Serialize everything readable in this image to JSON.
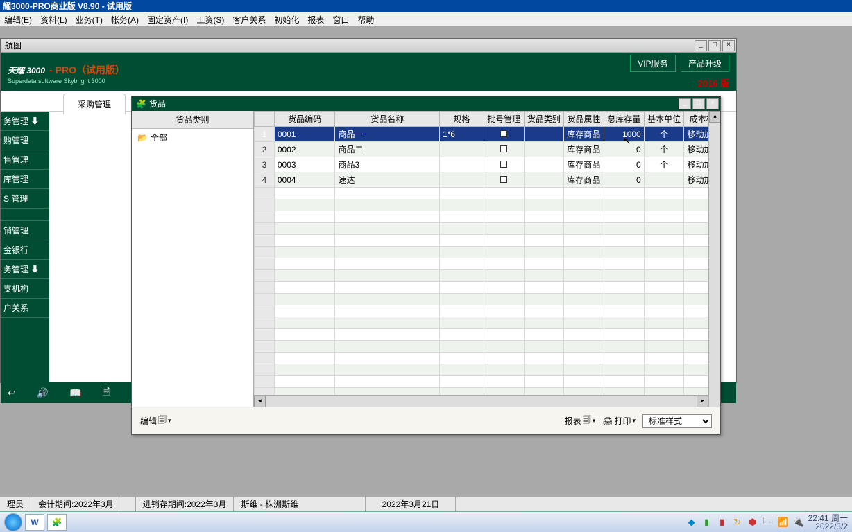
{
  "app": {
    "title": "耀3000-PRO商业版 V8.90 - 试用版"
  },
  "menu": [
    "编辑(E)",
    "资料(L)",
    "业务(T)",
    "帐务(A)",
    "固定资产(I)",
    "工资(S)",
    "客户关系",
    "初始化",
    "报表",
    "窗口",
    "帮助"
  ],
  "nav": {
    "title": "航图",
    "brand_title": "天耀 3000",
    "brand_pro": "- PRO（试用版）",
    "brand_sub": "Superdata software Skybright 3000",
    "vip_btn": "VIP服务",
    "upgrade_btn": "产品升级",
    "year": "2016 版",
    "tab_active": "采购管理",
    "sidebar": [
      "务管理 ⬇",
      "购管理",
      "售管理",
      "库管理",
      "S 管理",
      "",
      "销管理",
      "金银行",
      "务管理 ⬇",
      "支机构",
      "户关系"
    ]
  },
  "goods": {
    "title": "货品",
    "tree_header": "货品类别",
    "tree_root": "全部",
    "columns": [
      "",
      "货品编码",
      "货品名称",
      "规格",
      "批号管理",
      "货品类别",
      "货品属性",
      "总库存量",
      "基本单位",
      "成本栏"
    ],
    "rows": [
      {
        "n": "1",
        "code": "0001",
        "name": "商品一",
        "spec": "1*6",
        "batch": true,
        "cat": "",
        "attr": "库存商品",
        "stock": "1000",
        "unit": "个",
        "cost": "移动加"
      },
      {
        "n": "2",
        "code": "0002",
        "name": "商品二",
        "spec": "",
        "batch": false,
        "cat": "",
        "attr": "库存商品",
        "stock": "0",
        "unit": "个",
        "cost": "移动加"
      },
      {
        "n": "3",
        "code": "0003",
        "name": "商品3",
        "spec": "",
        "batch": false,
        "cat": "",
        "attr": "库存商品",
        "stock": "0",
        "unit": "个",
        "cost": "移动加"
      },
      {
        "n": "4",
        "code": "0004",
        "name": "速达",
        "spec": "",
        "batch": false,
        "cat": "",
        "attr": "库存商品",
        "stock": "0",
        "unit": "",
        "cost": "移动加"
      }
    ],
    "footer": {
      "edit": "编辑",
      "report": "报表",
      "print": "打印",
      "style": "标准样式"
    }
  },
  "status": {
    "user": "理员",
    "period": "会计期间:2022年3月",
    "inv_period": "进销存期间:2022年3月",
    "company": "斯维 - 株洲斯维",
    "date": "2022年3月21日"
  },
  "taskbar": {
    "time": "22:41 周一",
    "date": "2022/3/2"
  }
}
